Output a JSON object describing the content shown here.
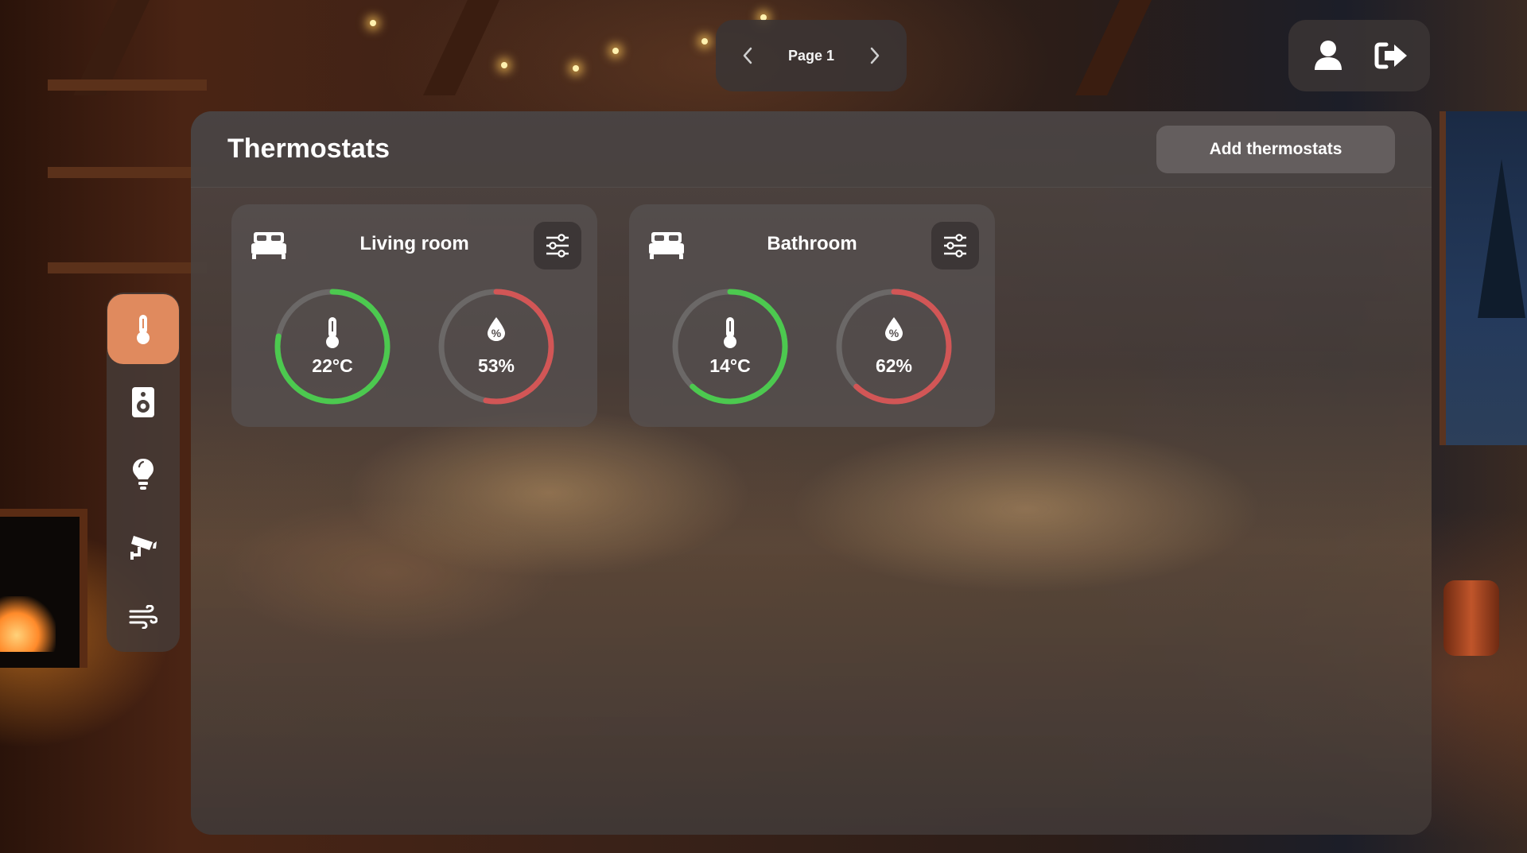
{
  "pager": {
    "label": "Page 1"
  },
  "rail": {
    "items": [
      {
        "icon": "thermometer-icon",
        "active": true
      },
      {
        "icon": "speaker-icon",
        "active": false
      },
      {
        "icon": "lightbulb-icon",
        "active": false
      },
      {
        "icon": "security-camera-icon",
        "active": false
      },
      {
        "icon": "wind-icon",
        "active": false
      }
    ],
    "accent": "#e08a5e"
  },
  "panel": {
    "title": "Thermostats",
    "add_label": "Add thermostats"
  },
  "thermostats": [
    {
      "name": "Living room",
      "icon": "bed-icon",
      "temperature": "22°C",
      "temperature_fill": 0.78,
      "humidity": "53%",
      "humidity_fill": 0.53
    },
    {
      "name": "Bathroom",
      "icon": "bed-icon",
      "temperature": "14°C",
      "temperature_fill": 0.62,
      "humidity": "62%",
      "humidity_fill": 0.62
    }
  ],
  "colors": {
    "temperature_ring": "#4cc94f",
    "humidity_ring": "#d25656",
    "ring_track": "#6b6867"
  }
}
